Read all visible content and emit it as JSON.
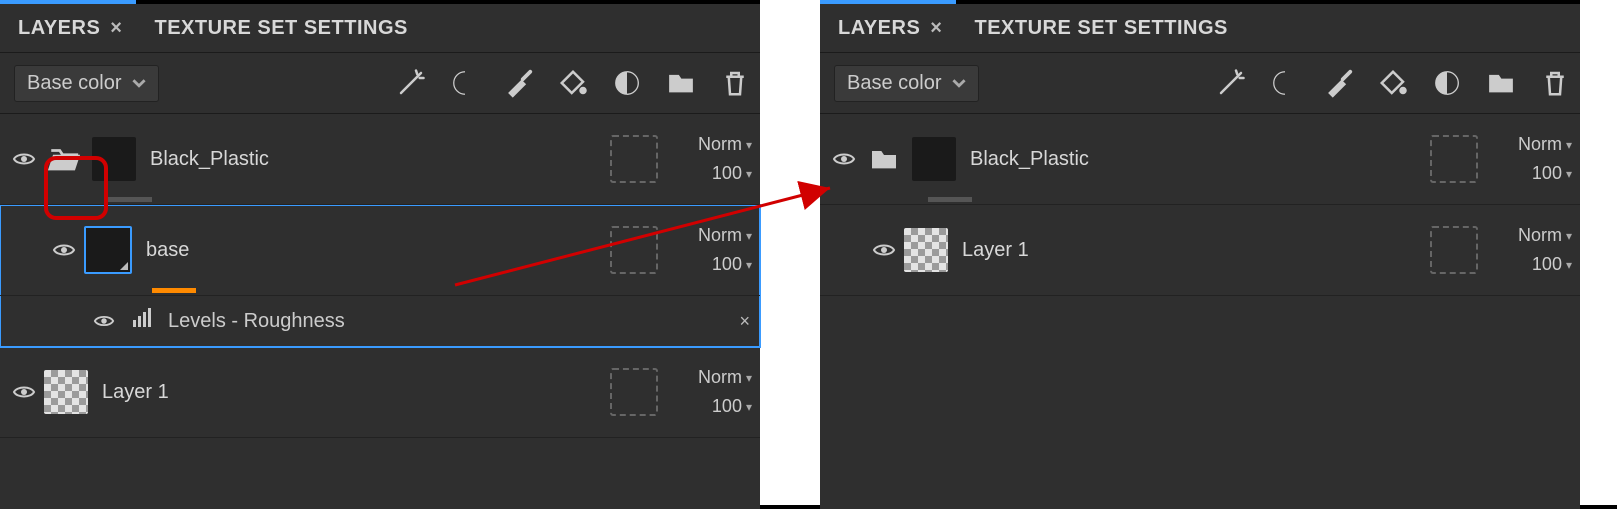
{
  "tabs": {
    "layers": "LAYERS",
    "texture_set": "TEXTURE SET SETTINGS"
  },
  "toolbar": {
    "channel": "Base color"
  },
  "blend": {
    "mode": "Norm",
    "opacity": "100"
  },
  "panelA": {
    "folder": {
      "name": "Black_Plastic"
    },
    "base": {
      "name": "base"
    },
    "effect": {
      "name": "Levels - Roughness"
    },
    "layer1": {
      "name": "Layer 1"
    }
  },
  "panelB": {
    "folder": {
      "name": "Black_Plastic"
    },
    "layer1": {
      "name": "Layer 1"
    }
  },
  "icons": {
    "wand": "wand-icon",
    "smart": "smart-mask-icon",
    "brush": "brush-icon",
    "bucket": "bucket-icon",
    "smartmat": "smart-material-icon",
    "folder": "folder-icon",
    "trash": "trash-icon"
  }
}
